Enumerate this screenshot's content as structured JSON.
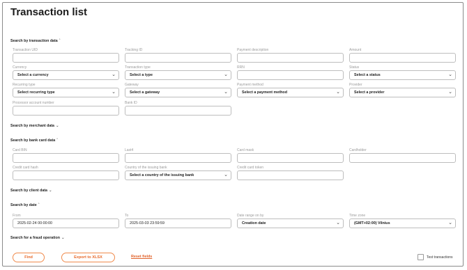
{
  "title": "Transaction list",
  "sections": {
    "transaction": "Search by transaction data",
    "merchant": "Search by merchant data",
    "bank_card": "Search by bank card data",
    "client": "Search by client data",
    "date": "Search by date",
    "fraud": "Search for a fraud operation"
  },
  "fields": {
    "transaction_uid": {
      "label": "Transaction UID",
      "value": ""
    },
    "tracking_id": {
      "label": "Tracking ID",
      "value": ""
    },
    "payment_description": {
      "label": "Payment description",
      "value": ""
    },
    "amount": {
      "label": "Amount",
      "value": ""
    },
    "currency": {
      "label": "Currency",
      "value": "Select a currency"
    },
    "transaction_type": {
      "label": "Transaction type",
      "value": "Select a type"
    },
    "rrn": {
      "label": "RRN",
      "value": ""
    },
    "status": {
      "label": "Status",
      "value": "Select a status"
    },
    "recurring_type": {
      "label": "Recurring type",
      "value": "Select recurring type"
    },
    "gateway": {
      "label": "Gateway",
      "value": "Select a gateway"
    },
    "payment_method": {
      "label": "Payment method",
      "value": "Select a payment method"
    },
    "provider": {
      "label": "Provider",
      "value": "Select a provider"
    },
    "processor_account_number": {
      "label": "Processor account number",
      "value": ""
    },
    "bank_id": {
      "label": "Bank ID",
      "value": ""
    },
    "card_bin": {
      "label": "Card BIN",
      "value": ""
    },
    "last4": {
      "label": "Last4",
      "value": ""
    },
    "card_mask": {
      "label": "Card mask",
      "value": ""
    },
    "cardholder": {
      "label": "Cardholder",
      "value": ""
    },
    "credit_card_hash": {
      "label": "Credit card hash",
      "value": ""
    },
    "issuing_country": {
      "label": "Country of the issuing bank",
      "value": "Select a country of the issuing bank"
    },
    "credit_card_token": {
      "label": "Credit card token",
      "value": ""
    },
    "from": {
      "label": "From",
      "value": "2025-02-24 00:00:00"
    },
    "to": {
      "label": "To",
      "value": "2025-03-03 23:59:59"
    },
    "date_range_on": {
      "label": "Date range on by",
      "value": "Creation date"
    },
    "time_zone": {
      "label": "Time zone",
      "value": "(GMT+02:00) Vilnius"
    }
  },
  "buttons": {
    "find": "Find",
    "export": "Export to XLSX",
    "reset": "Reset fields"
  },
  "test_transactions": {
    "label": "Test transactions",
    "checked": false
  },
  "colors": {
    "accent": "#e86a2a",
    "border": "#bdbdbd"
  }
}
